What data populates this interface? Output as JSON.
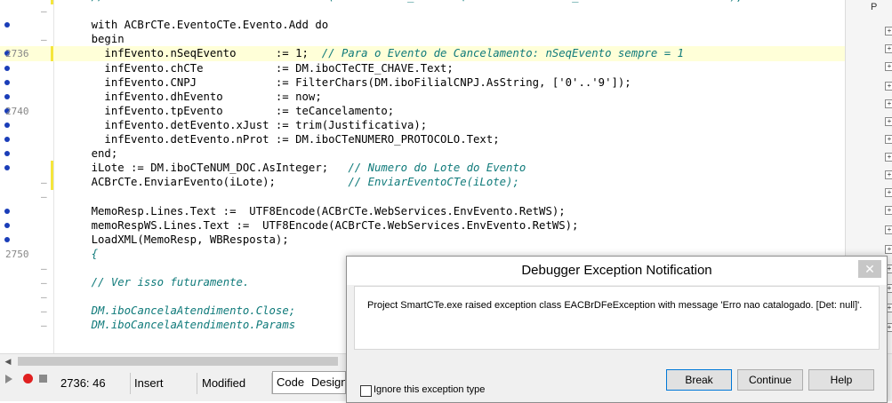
{
  "editor": {
    "lines": [
      {
        "num": "",
        "dot": false,
        "dash": true,
        "mark": true,
        "current": false,
        "code": "    ",
        "comment": "//ACBrCTe.Conhecimentos.LoadFromFile(DM.sPathCTE_Can + '\\' + dm.iboCTeCTE_CHAVE.Text + '-cte.xml');"
      },
      {
        "num": "",
        "dot": false,
        "dash": true,
        "mark": false,
        "current": false,
        "code": "",
        "comment": ""
      },
      {
        "num": "",
        "dot": true,
        "dash": false,
        "mark": false,
        "current": false,
        "code": "    with ACBrCTe.EventoCTe.Evento.Add do",
        "comment": ""
      },
      {
        "num": "",
        "dot": false,
        "dash": true,
        "mark": false,
        "current": false,
        "code": "    begin",
        "comment": ""
      },
      {
        "num": "2736",
        "dot": true,
        "dash": false,
        "mark": true,
        "current": true,
        "code": "      infEvento.nSeqEvento      := 1;  ",
        "comment": "// Para o Evento de Cancelamento: nSeqEvento sempre = 1"
      },
      {
        "num": "",
        "dot": true,
        "dash": false,
        "mark": false,
        "current": false,
        "code": "      infEvento.chCTe           := DM.iboCTeCTE_CHAVE.Text;",
        "comment": ""
      },
      {
        "num": "",
        "dot": true,
        "dash": false,
        "mark": false,
        "current": false,
        "code": "      infEvento.CNPJ            := FilterChars(DM.iboFilialCNPJ.AsString, ['0'..'9']);",
        "comment": ""
      },
      {
        "num": "",
        "dot": true,
        "dash": false,
        "mark": false,
        "current": false,
        "code": "      infEvento.dhEvento        := now;",
        "comment": ""
      },
      {
        "num": "2740",
        "dot": true,
        "dash": false,
        "mark": false,
        "current": false,
        "code": "      infEvento.tpEvento        := teCancelamento;",
        "comment": ""
      },
      {
        "num": "",
        "dot": true,
        "dash": false,
        "mark": false,
        "current": false,
        "code": "      infEvento.detEvento.xJust := trim(Justificativa);",
        "comment": ""
      },
      {
        "num": "",
        "dot": true,
        "dash": false,
        "mark": false,
        "current": false,
        "code": "      infEvento.detEvento.nProt := DM.iboCTeNUMERO_PROTOCOLO.Text;",
        "comment": ""
      },
      {
        "num": "",
        "dot": true,
        "dash": false,
        "mark": false,
        "current": false,
        "code": "    end;",
        "comment": ""
      },
      {
        "num": "",
        "dot": true,
        "dash": false,
        "mark": true,
        "current": false,
        "code": "    iLote := DM.iboCTeNUM_DOC.AsInteger;   ",
        "comment": "// Numero do Lote do Evento"
      },
      {
        "num": "",
        "dot": false,
        "dash": true,
        "mark": true,
        "current": false,
        "code": "    ACBrCTe.EnviarEvento(iLote);           ",
        "comment": "// EnviarEventoCTe(iLote);"
      },
      {
        "num": "",
        "dot": false,
        "dash": true,
        "mark": false,
        "current": false,
        "code": "",
        "comment": ""
      },
      {
        "num": "",
        "dot": true,
        "dash": false,
        "mark": false,
        "current": false,
        "code": "    MemoResp.Lines.Text :=  UTF8Encode(ACBrCTe.WebServices.EnvEvento.RetWS);",
        "comment": ""
      },
      {
        "num": "",
        "dot": true,
        "dash": false,
        "mark": false,
        "current": false,
        "code": "    memoRespWS.Lines.Text :=  UTF8Encode(ACBrCTe.WebServices.EnvEvento.RetWS);",
        "comment": ""
      },
      {
        "num": "",
        "dot": true,
        "dash": false,
        "mark": false,
        "current": false,
        "code": "    LoadXML(MemoResp, WBResposta);",
        "comment": ""
      },
      {
        "num": "2750",
        "dot": false,
        "dash": false,
        "mark": false,
        "current": false,
        "code": "    ",
        "comment": "{"
      },
      {
        "num": "",
        "dot": false,
        "dash": true,
        "mark": false,
        "current": false,
        "code": "",
        "comment": ""
      },
      {
        "num": "",
        "dot": false,
        "dash": true,
        "mark": false,
        "current": false,
        "code": "    ",
        "comment": "// Ver isso futuramente."
      },
      {
        "num": "",
        "dot": false,
        "dash": true,
        "mark": false,
        "current": false,
        "code": "",
        "comment": ""
      },
      {
        "num": "",
        "dot": false,
        "dash": true,
        "mark": false,
        "current": false,
        "code": "    ",
        "comment": "DM.iboCancelaAtendimento.Close;"
      },
      {
        "num": "",
        "dot": false,
        "dash": true,
        "mark": false,
        "current": false,
        "code": "    ",
        "comment": "DM.iboCancelaAtendimento.Params"
      }
    ]
  },
  "statusbar": {
    "position": "2736:  46",
    "mode": "Insert",
    "state": "Modified",
    "tab_code": "Code",
    "tab_design": "Design"
  },
  "dialog": {
    "title": "Debugger Exception Notification",
    "close_glyph": "✕",
    "message": "Project SmartCTe.exe raised exception class EACBrDFeException with message 'Erro nao catalogado. [Det: null]'.",
    "btn_break": "Break",
    "btn_continue": "Continue",
    "btn_help": "Help",
    "ignore_label": "Ignore this exception type"
  },
  "rightpanel": {
    "plus_glyph": "+",
    "label": "P"
  }
}
